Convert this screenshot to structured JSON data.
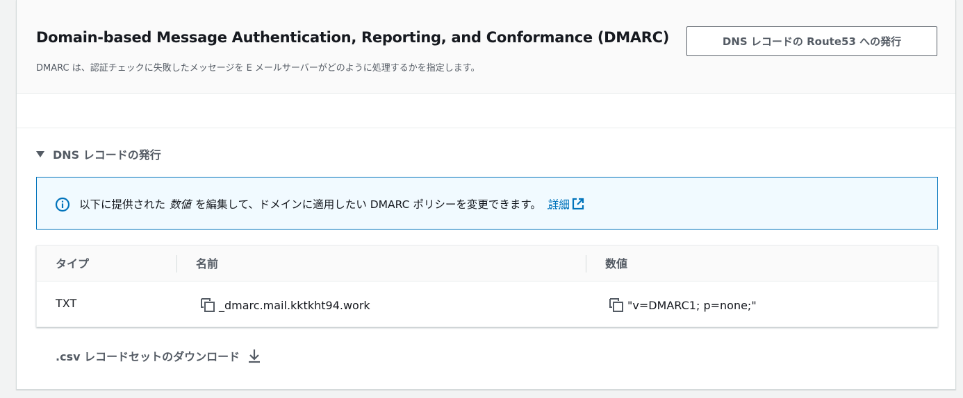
{
  "dmarc": {
    "title": "Domain-based Message Authentication, Reporting, and Conformance (DMARC)",
    "description": "DMARC は、認証チェックに失敗したメッセージを E メールサーバーがどのように処理するかを指定します。",
    "publish_button": "DNS レコードの Route53 への発行"
  },
  "dns_records": {
    "expander_label": "DNS レコードの発行",
    "info": {
      "text_before": "以下に提供された",
      "text_emphasis": "数値",
      "text_after": "を編集して、ドメインに適用したい DMARC ポリシーを変更できます。",
      "link_label": "詳細"
    },
    "table": {
      "headers": [
        "タイプ",
        "名前",
        "数値"
      ],
      "rows": [
        {
          "type": "TXT",
          "name": "_dmarc.mail.kktkht94.work",
          "value": "\"v=DMARC1; p=none;\""
        }
      ]
    },
    "download_label": ".csv レコードセットのダウンロード"
  },
  "colors": {
    "accent": "#0073bb",
    "info_bg": "#f1faff",
    "text_secondary": "#545b64"
  }
}
